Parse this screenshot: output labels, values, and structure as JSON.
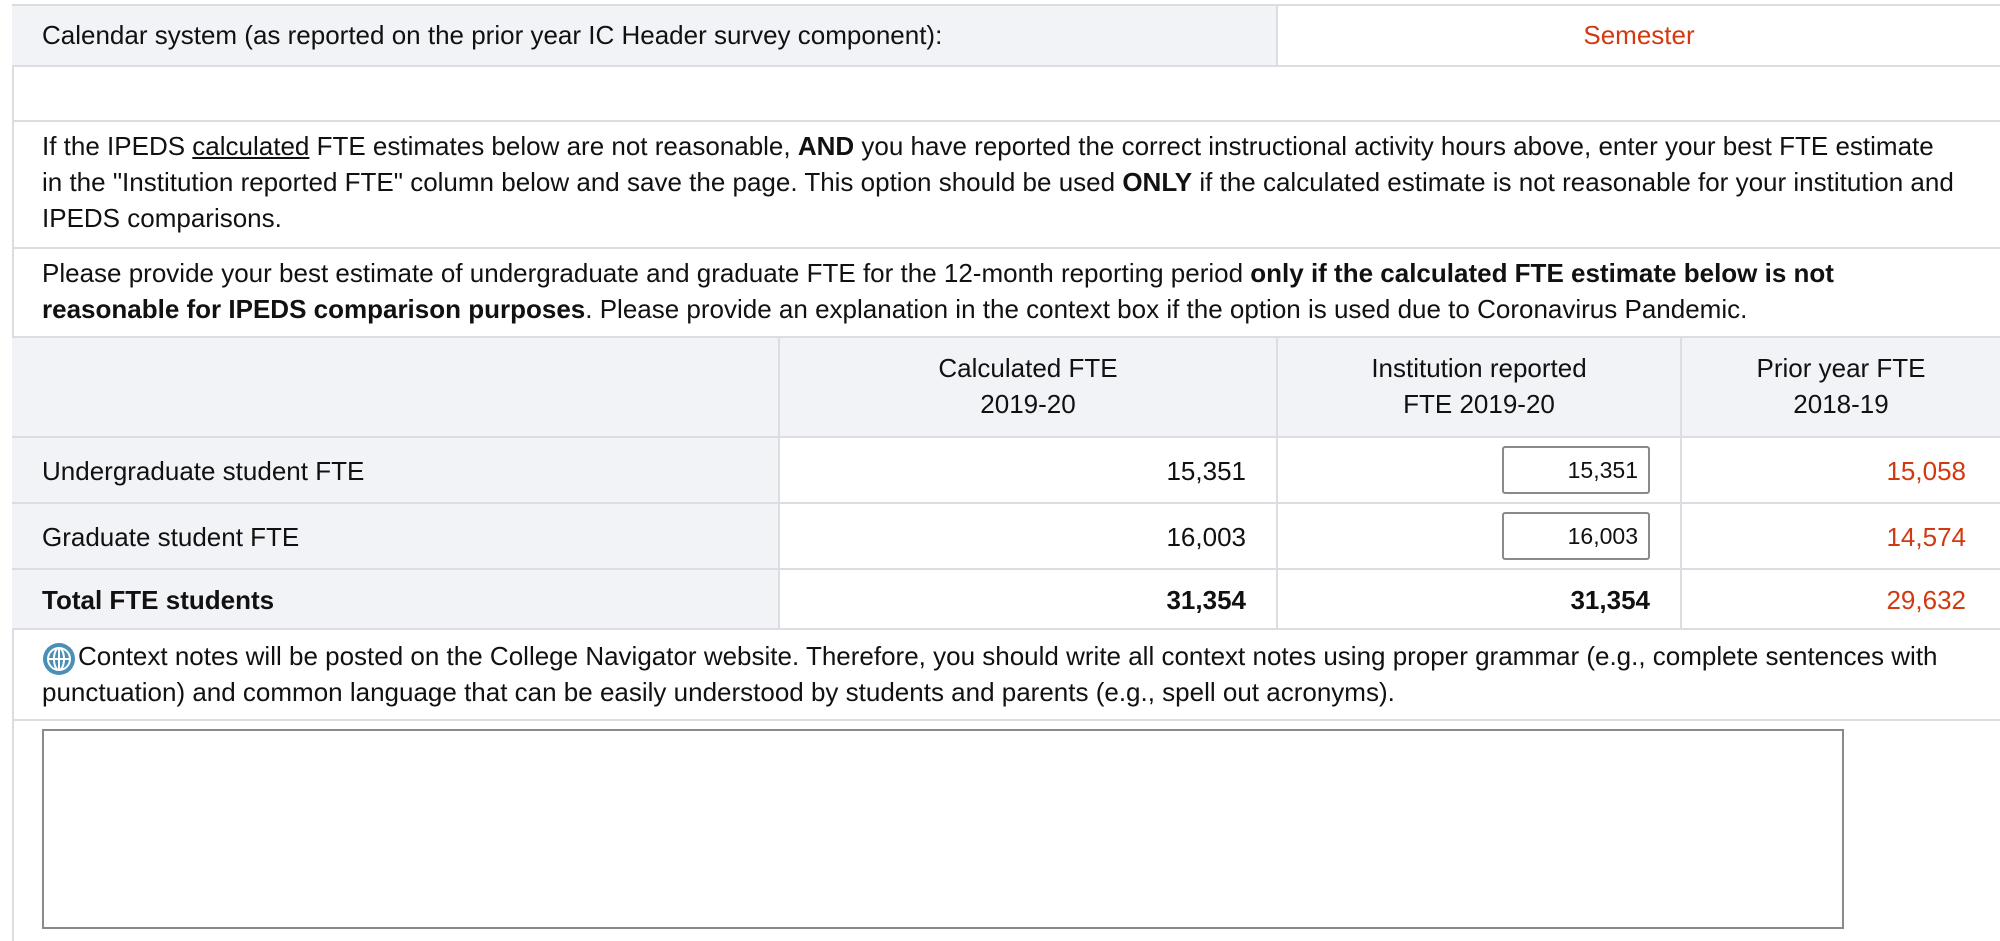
{
  "calendar": {
    "label": "Calendar system (as reported on the prior year IC Header survey component):",
    "value": "Semester"
  },
  "instructions": {
    "p1_a": "If the IPEDS ",
    "p1_underline": "calculated",
    "p1_b": " FTE estimates below are not reasonable, ",
    "p1_bold1": "AND",
    "p1_c": " you have reported the correct instructional activity hours above, enter your best FTE estimate in the \"Institution reported FTE\" column below and save the page. This option should be used ",
    "p1_bold2": "ONLY",
    "p1_d": " if the calculated estimate is not reasonable for your institution and IPEDS comparisons.",
    "p2_a": "Please provide your best estimate of undergraduate and graduate FTE for the 12-month reporting period ",
    "p2_bold": "only if the calculated FTE estimate below is not reasonable for IPEDS comparison purposes",
    "p2_b": ". Please provide an explanation in the context box if the option is used due to Coronavirus Pandemic."
  },
  "table": {
    "headers": {
      "calc_line1": "Calculated FTE",
      "calc_line2": "2019-20",
      "inst_line1": "Institution reported",
      "inst_line2": "FTE 2019-20",
      "prior_line1": "Prior year FTE",
      "prior_line2": "2018-19"
    },
    "rows": [
      {
        "label": "Undergraduate student FTE",
        "calculated": "15,351",
        "institution": "15,351",
        "prior": "15,058"
      },
      {
        "label": "Graduate student FTE",
        "calculated": "16,003",
        "institution": "16,003",
        "prior": "14,574"
      }
    ],
    "total": {
      "label": "Total FTE students",
      "calculated": "31,354",
      "institution": "31,354",
      "prior": "29,632"
    }
  },
  "context": {
    "note": "Context notes will be posted on the College Navigator website. Therefore, you should write all context notes using proper grammar (e.g., complete sentences with punctuation) and common language that can be easily understood by students and parents (e.g., spell out acronyms).",
    "icon": "globe-icon",
    "textarea_value": ""
  },
  "colors": {
    "accent_red": "#d13a10",
    "header_shade": "#f2f3f6",
    "border": "#dcdde2",
    "icon_blue": "#4a8fb5"
  }
}
